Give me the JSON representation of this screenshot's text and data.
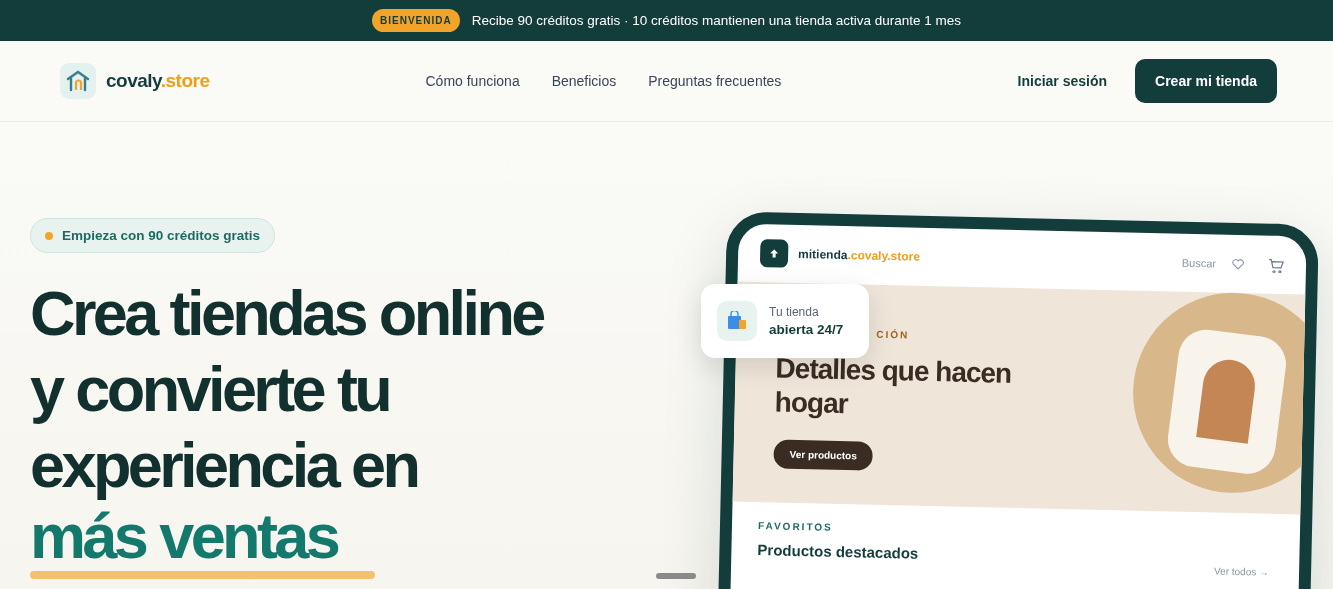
{
  "announcement": {
    "badge": "BIENVENIDA",
    "text": "Recibe 90 créditos gratis · 10 créditos mantienen una tienda activa durante 1 mes"
  },
  "nav": {
    "logo": {
      "name": "covaly",
      "suffix": ".store"
    },
    "links": [
      "Cómo funciona",
      "Beneficios",
      "Preguntas frecuentes"
    ],
    "login": "Iniciar sesión",
    "cta": "Crear mi tienda"
  },
  "hero": {
    "pill": "Empieza con 90 créditos gratis",
    "headline": [
      "Crea tiendas online",
      "y convierte tu",
      "experiencia en"
    ],
    "highlight": "más ventas"
  },
  "mockup": {
    "domain": {
      "name": "mitienda",
      "suffix": ".covaly.store"
    },
    "search": "Buscar",
    "banner": {
      "kicker": "CIÓN",
      "title": "Detalles que hacen hogar",
      "button": "Ver productos"
    },
    "section": {
      "kicker": "FAVORITOS",
      "title": "Productos destacados",
      "link": "Ver todos →"
    }
  },
  "floating_card": {
    "label": "Tu tienda",
    "value": "abierta 24/7"
  }
}
